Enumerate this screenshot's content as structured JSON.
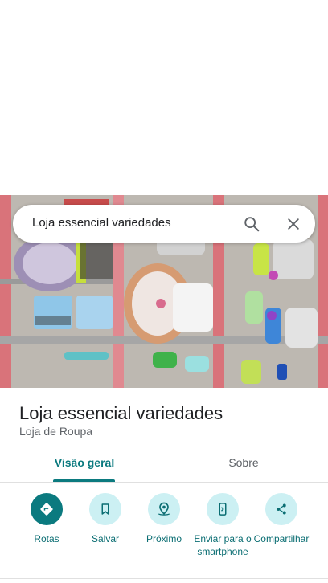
{
  "search": {
    "query": "Loja essencial variedades"
  },
  "place": {
    "name": "Loja essencial variedades",
    "category": "Loja de Roupa"
  },
  "tabs": [
    {
      "label": "Visão geral"
    },
    {
      "label": "Sobre"
    }
  ],
  "actions": [
    {
      "label": "Rotas",
      "icon": "directions-icon"
    },
    {
      "label": "Salvar",
      "icon": "bookmark-icon"
    },
    {
      "label": "Próximo",
      "icon": "nearby-icon"
    },
    {
      "label": "Enviar para o smartphone",
      "icon": "send-to-phone-icon"
    },
    {
      "label": "Compartilhar",
      "icon": "share-icon"
    }
  ],
  "colors": {
    "accent": "#0b7a7f",
    "action_bg": "#ccf0f3"
  }
}
